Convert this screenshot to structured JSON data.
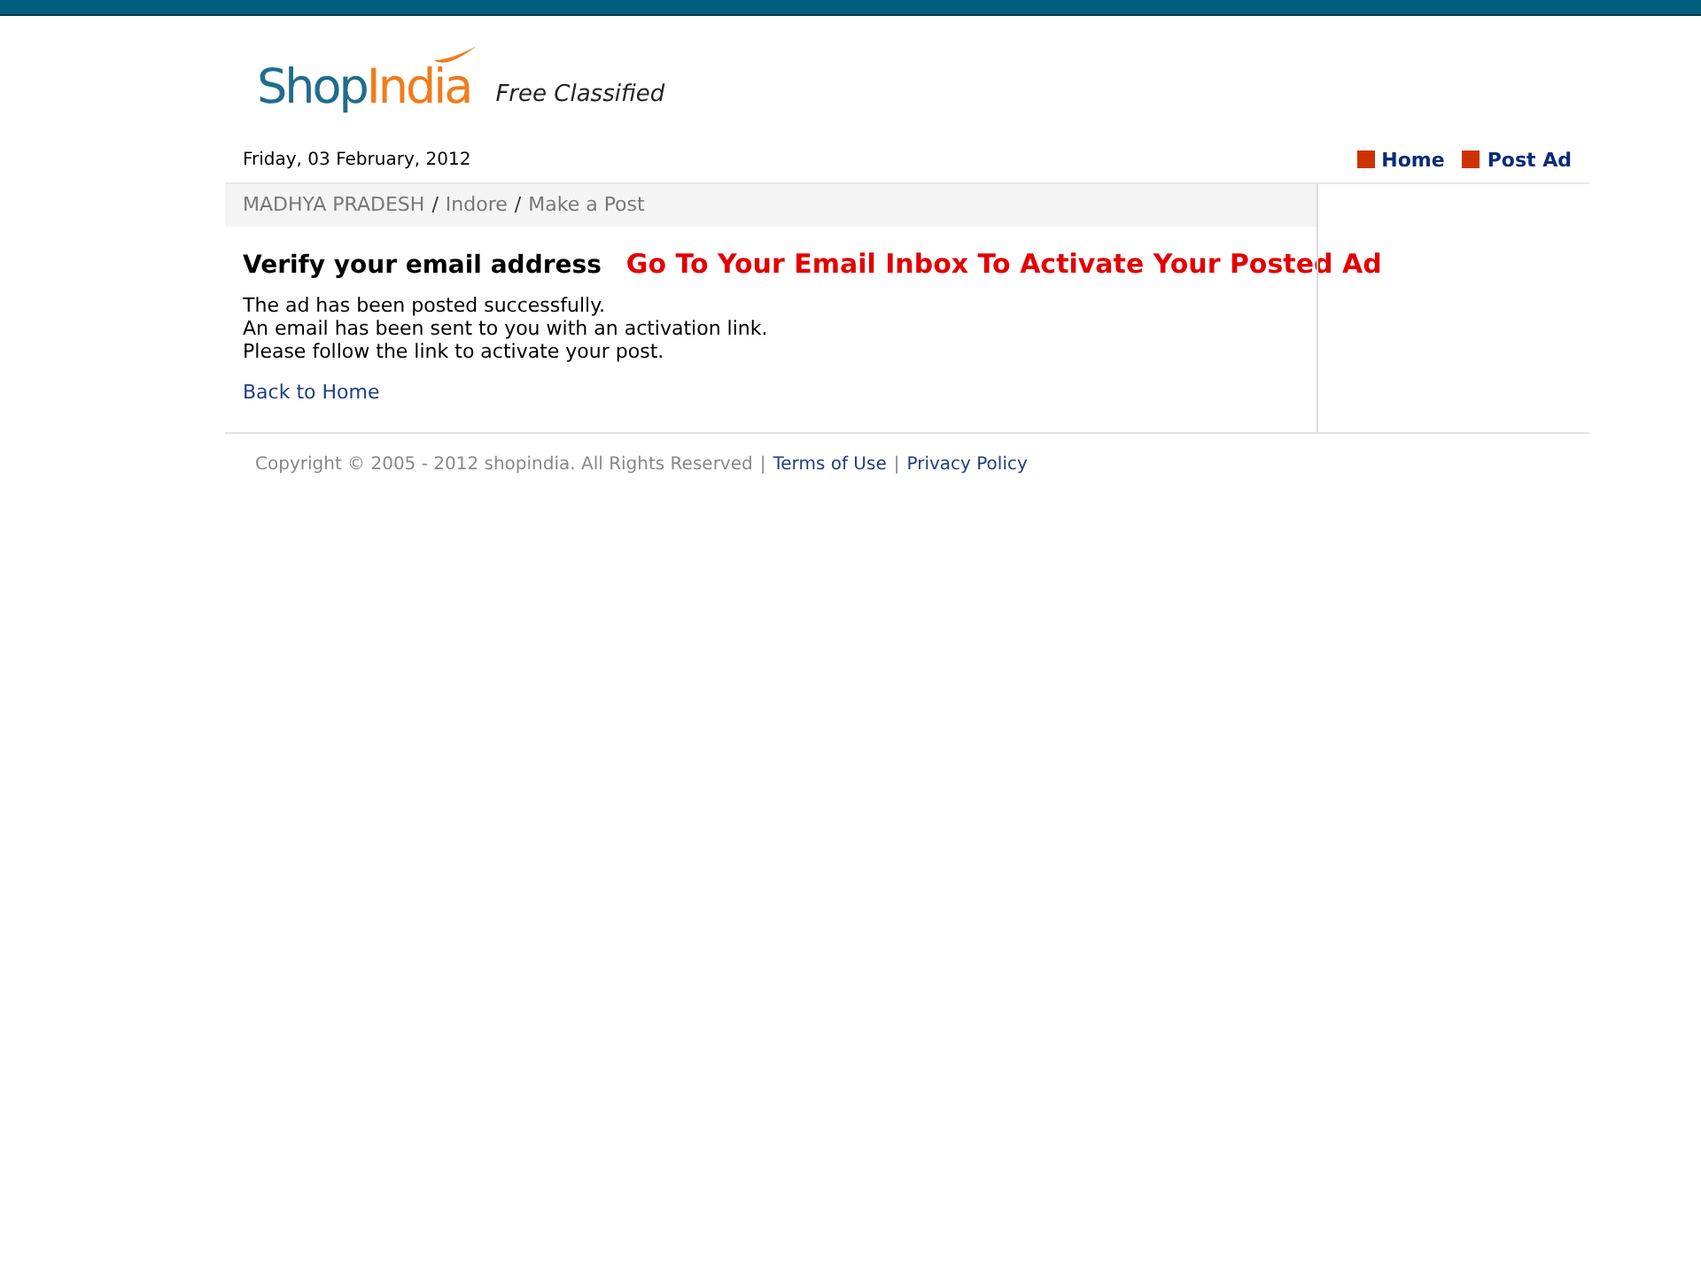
{
  "logo": {
    "part_1": "Shop",
    "part_2": "India",
    "tagline": "Free Classified"
  },
  "date": "Friday, 03 February, 2012",
  "nav": [
    "Home",
    "Post Ad"
  ],
  "breadcrumb": {
    "items": [
      "MADHYA PRADESH",
      "Indore",
      "Make a Post"
    ],
    "separator": "/"
  },
  "heading": "Verify your email address",
  "annotation": "Go To Your Email Inbox To Activate Your Posted Ad",
  "message": [
    "The ad has been posted successfully.",
    "An email has been sent to you with an activation link.",
    "Please follow the link to activate your post."
  ],
  "back_link": "Back to Home",
  "footer": {
    "copyright": "Copyright © 2005 - 2012 shopindia. All Rights Reserved",
    "separator": "|",
    "links": [
      "Terms of Use",
      "Privacy Policy"
    ]
  }
}
